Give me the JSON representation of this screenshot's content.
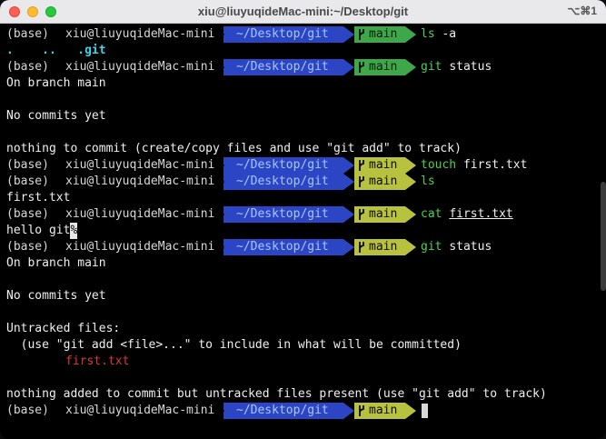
{
  "window": {
    "title": "xiu@liuyuqideMac-mini:~/Desktop/git",
    "shortcut": "⌥⌘1"
  },
  "prompt": {
    "env": "(base)",
    "host": "xiu@liuyuqideMac-mini",
    "dir": "~/Desktop/git",
    "branch": "main"
  },
  "colors": {
    "dir_bg": "#2b45c4",
    "branch_clean_bg": "#3da74a",
    "branch_dirty_bg": "#b8c23e",
    "cmd": "#4cd14f",
    "untracked": "#e0362e",
    "dir_listing": "#3fd2e6"
  },
  "icons": {
    "branch": "git-branch-icon"
  },
  "lines": [
    {
      "cmd": "ls",
      "arg": "-a"
    },
    {
      "listing": ".    ..   .git"
    },
    {
      "cmd": "git",
      "arg": "status"
    },
    {
      "out": "On branch main"
    },
    {
      "out": ""
    },
    {
      "out": "No commits yet"
    },
    {
      "out": ""
    },
    {
      "out": "nothing to commit (create/copy files and use \"git add\" to track)"
    },
    {
      "cmd": "touch",
      "arg": "first.txt"
    },
    {
      "cmd": "ls",
      "arg": ""
    },
    {
      "out": "first.txt"
    },
    {
      "cmd": "cat",
      "arg": "first.txt"
    },
    {
      "out": "hello git",
      "mark": "%"
    },
    {
      "cmd": "git",
      "arg": "status"
    },
    {
      "out": "On branch main"
    },
    {
      "out": ""
    },
    {
      "out": "No commits yet"
    },
    {
      "out": ""
    },
    {
      "out": "Untracked files:"
    },
    {
      "out": "  (use \"git add <file>...\" to include in what will be committed)"
    },
    {
      "untracked": "first.txt"
    },
    {
      "out": ""
    },
    {
      "out": "nothing added to commit but untracked files present (use \"git add\" to track)"
    }
  ]
}
